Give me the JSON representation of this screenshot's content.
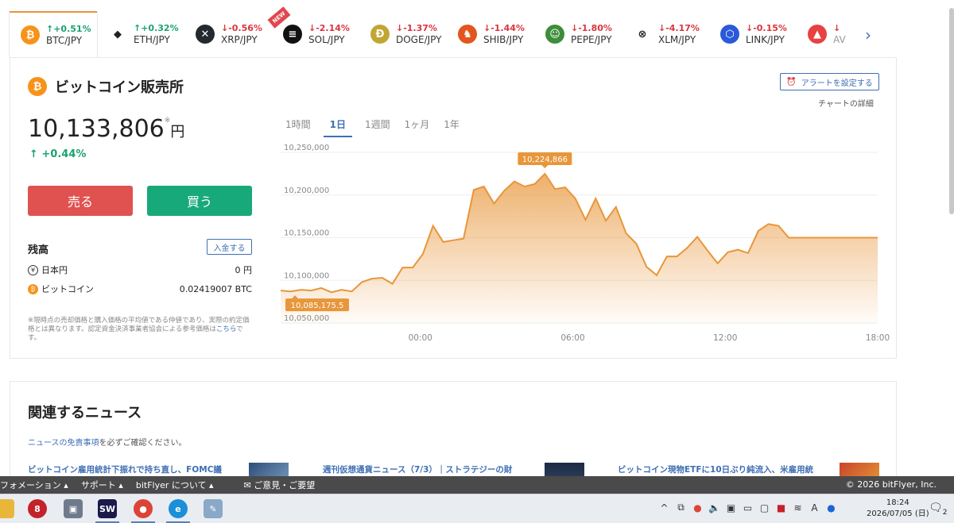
{
  "tickers": [
    {
      "change": "+0.51%",
      "dir": "up",
      "pair": "BTC/JPY",
      "icon": "bitcoin-icon",
      "color": "#f7931a",
      "glyph": "₿",
      "active": true
    },
    {
      "change": "+0.32%",
      "dir": "up",
      "pair": "ETH/JPY",
      "icon": "ethereum-icon",
      "color": "#ffffff",
      "glyph": "◆"
    },
    {
      "change": "-0.56%",
      "dir": "down",
      "pair": "XRP/JPY",
      "icon": "xrp-icon",
      "color": "#23292f",
      "glyph": "✕"
    },
    {
      "change": "-2.14%",
      "dir": "down",
      "pair": "SOL/JPY",
      "icon": "solana-icon",
      "color": "#111111",
      "glyph": "≡",
      "badge": "NEW"
    },
    {
      "change": "-1.37%",
      "dir": "down",
      "pair": "DOGE/JPY",
      "icon": "dogecoin-icon",
      "color": "#c2a633",
      "glyph": "Ð"
    },
    {
      "change": "-1.44%",
      "dir": "down",
      "pair": "SHIB/JPY",
      "icon": "shiba-icon",
      "color": "#e3551f",
      "glyph": "♞"
    },
    {
      "change": "-1.80%",
      "dir": "down",
      "pair": "PEPE/JPY",
      "icon": "pepe-icon",
      "color": "#3d8d3a",
      "glyph": "☺"
    },
    {
      "change": "-4.17%",
      "dir": "down",
      "pair": "XLM/JPY",
      "icon": "stellar-icon",
      "color": "#ffffff",
      "glyph": "⊗"
    },
    {
      "change": "-0.15%",
      "dir": "down",
      "pair": "LINK/JPY",
      "icon": "chainlink-icon",
      "color": "#2a5ada",
      "glyph": "⬡"
    },
    {
      "change": "",
      "dir": "down",
      "pair": "AV",
      "icon": "avalanche-icon",
      "color": "#e84142",
      "glyph": "▲"
    }
  ],
  "header": {
    "title": "ビットコイン販売所",
    "alert_button": "アラートを設定する",
    "chart_detail": "チャートの詳細"
  },
  "price": {
    "value": "10,133,806",
    "mark": "※",
    "unit": "円",
    "change": "↑ +0.44%"
  },
  "actions": {
    "sell": "売る",
    "buy": "買う"
  },
  "balance": {
    "label": "残高",
    "deposit_button": "入金する",
    "rows": [
      {
        "name": "日本円",
        "value": "0 円",
        "icon": "yen-icon"
      },
      {
        "name": "ビットコイン",
        "value": "0.02419007 BTC",
        "icon": "bitcoin-icon"
      }
    ]
  },
  "note": {
    "text": "※現時点の売却価格と購入価格の平均値である仲値であり、実際の約定価格とは異なります。認定資金決済事業者協会による参考価格は",
    "link": "こちら",
    "tail": "です。"
  },
  "ranges": [
    "1時間",
    "1日",
    "1週間",
    "1ヶ月",
    "1年"
  ],
  "active_range": "1日",
  "chart_data": {
    "type": "area",
    "y_ticks": [
      "10,250,000",
      "10,200,000",
      "10,150,000",
      "10,100,000",
      "10,050,000"
    ],
    "ylim": [
      10050000,
      10250000
    ],
    "x_ticks": [
      "00:00",
      "06:00",
      "12:00",
      "18:00"
    ],
    "xlim": [
      -5.5,
      18.0
    ],
    "high_label": "10,224,866",
    "low_label": "10,085,175.5",
    "high": 10224866,
    "low": 10085175.5,
    "color": "#e8963a",
    "x": [
      -5.5,
      -5.1,
      -4.7,
      -4.3,
      -3.9,
      -3.5,
      -3.1,
      -2.7,
      -2.3,
      -1.9,
      -1.5,
      -1.1,
      -0.7,
      -0.3,
      0.1,
      0.5,
      0.9,
      1.3,
      1.7,
      2.1,
      2.5,
      2.9,
      3.3,
      3.7,
      4.1,
      4.5,
      4.9,
      5.3,
      5.7,
      6.1,
      6.5,
      6.9,
      7.3,
      7.7,
      8.1,
      8.5,
      8.9,
      9.3,
      9.7,
      10.1,
      10.5,
      10.9,
      11.3,
      11.7,
      12.1,
      12.5,
      12.9,
      13.3,
      13.7,
      14.1,
      14.5,
      14.9,
      15.3,
      15.7,
      16.1,
      16.5,
      16.9,
      17.3,
      17.7,
      18.0
    ],
    "y": [
      10088000,
      10087000,
      10089000,
      10088000,
      10091000,
      10086000,
      10089000,
      10087000,
      10098000,
      10102000,
      10103000,
      10096000,
      10115000,
      10115000,
      10131000,
      10164000,
      10145000,
      10147000,
      10149000,
      10206000,
      10210000,
      10190000,
      10205000,
      10216000,
      10210000,
      10213000,
      10224866,
      10207000,
      10209000,
      10196000,
      10171000,
      10196000,
      10170000,
      10186000,
      10155000,
      10143000,
      10116000,
      10106000,
      10128000,
      10128000,
      10138000,
      10151000,
      10135000,
      10120000,
      10133000,
      10136000,
      10132000,
      10158000,
      10166000,
      10164000,
      10150000,
      10150000,
      10150000,
      10150000,
      10150000,
      10150000,
      10150000,
      10150000,
      10150000,
      10150000
    ]
  },
  "news": {
    "title": "関連するニュース",
    "disclaimer_link": "ニュースの免責事項",
    "disclaimer_tail": "を必ずご確認ください。",
    "items": [
      "ビットコイン雇用統計下振れで持ち直し、FOMC議",
      "週刊仮想通貨ニュース（7/3）｜ストラテジーの財",
      "ビットコイン現物ETFに10日ぶり純流入、米雇用統"
    ]
  },
  "footer": {
    "items": [
      "フォメーション ▴",
      "サポート ▴",
      "bitFlyer について ▴",
      "✉ ご意見・ご要望"
    ],
    "copyright": "© 2026 bitFlyer, Inc."
  },
  "taskbar": {
    "time": "18:24",
    "date": "2026/07/05 (日)",
    "notification_count": "2"
  }
}
